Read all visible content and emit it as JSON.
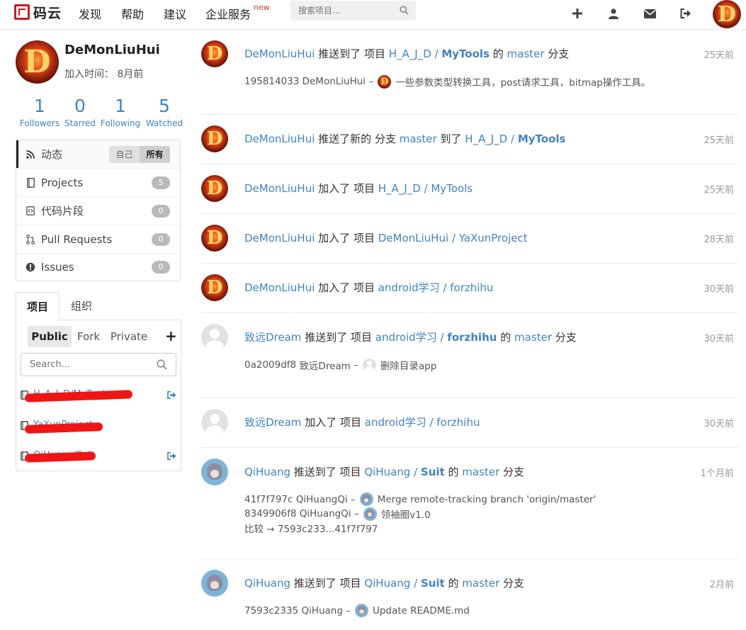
{
  "nav": {
    "logo_text": "码云",
    "items": [
      "发现",
      "帮助",
      "建议",
      "企业服务"
    ],
    "new_tag": "new",
    "search_placeholder": "搜索项目...",
    "avatar_letter": "D"
  },
  "profile": {
    "name": "DeMonLiuHui",
    "joined": "加入时间： 8月前",
    "avatar_letter": "D",
    "stats": [
      {
        "num": "1",
        "label": "Followers"
      },
      {
        "num": "0",
        "label": "Starred"
      },
      {
        "num": "1",
        "label": "Following"
      },
      {
        "num": "5",
        "label": "Watched"
      }
    ]
  },
  "menu": {
    "activity": "动态",
    "toggle_self": "自己",
    "toggle_all": "所有",
    "items": [
      {
        "label": "Projects",
        "count": "5"
      },
      {
        "label": "代码片段",
        "count": "0"
      },
      {
        "label": "Pull Requests",
        "count": "0"
      },
      {
        "label": "Issues",
        "count": "0"
      }
    ]
  },
  "projects_panel": {
    "tabs": [
      "项目",
      "组织"
    ],
    "filters": [
      "Public",
      "Fork",
      "Private"
    ],
    "add": "+",
    "search_placeholder": "Search...",
    "items": [
      "H_A_J_D/MyTools",
      "YaXunProject",
      "QiHuang/Suit"
    ]
  },
  "feed": [
    {
      "avatar": "D",
      "actor": "DeMonLiuHui",
      "action": "推送到了 项目",
      "repo_owner": "H_A_J_D",
      "repo_name": "MyTools",
      "suffix": "的",
      "branch": "master",
      "tail": "分支",
      "time": "25天前",
      "lines": [
        {
          "sha": "195814033",
          "author": "DeMonLiuHui",
          "msg": "一些参数类型转换工具，post请求工具，bitmap操作工具。"
        }
      ]
    },
    {
      "avatar": "D",
      "actor": "DeMonLiuHui",
      "action": "推送了新的 分支",
      "branch": "master",
      "mid": "到了",
      "repo_owner": "H_A_J_D",
      "repo_name": "MyTools",
      "time": "25天前"
    },
    {
      "avatar": "D",
      "actor": "DeMonLiuHui",
      "action": "加入了 项目",
      "repo": "H_A_J_D / MyTools",
      "time": "25天前"
    },
    {
      "avatar": "D",
      "actor": "DeMonLiuHui",
      "action": "加入了 项目",
      "repo": "DeMonLiuHui / YaXunProject",
      "time": "28天前"
    },
    {
      "avatar": "D",
      "actor": "DeMonLiuHui",
      "action": "加入了 项目",
      "repo": "android学习 / forzhihu",
      "time": "30天前"
    },
    {
      "avatar": "grey",
      "actor": "致远Dream",
      "action": "推送到了 项目",
      "repo_owner": "android学习",
      "repo_name": "forzhihu",
      "suffix": "的",
      "branch": "master",
      "tail": "分支",
      "time": "30天前",
      "lines": [
        {
          "sha": "0a2009df8",
          "author": "致远Dream",
          "msg": "删除目录app"
        }
      ]
    },
    {
      "avatar": "grey",
      "actor": "致远Dream",
      "action": "加入了 项目",
      "repo": "android学习 / forzhihu",
      "time": "30天前"
    },
    {
      "avatar": "cat",
      "actor": "QiHuang",
      "action": "推送到了 项目",
      "repo_owner": "QiHuang",
      "repo_name": "Suit",
      "suffix": "的",
      "branch": "master",
      "tail": "分支",
      "time": "1个月前",
      "lines": [
        {
          "sha": "41f7f797c",
          "author": "QiHuangQi",
          "msg": "Merge remote-tracking branch 'origin/master'"
        },
        {
          "sha": "8349906f8",
          "author": "QiHuangQi",
          "msg": "领袖圈v1.0"
        }
      ],
      "compare": "比较 → 7593c233...41f7f797"
    },
    {
      "avatar": "cat",
      "actor": "QiHuang",
      "action": "推送到了 项目",
      "repo_owner": "QiHuang",
      "repo_name": "Suit",
      "suffix": "的",
      "branch": "master",
      "tail": "分支",
      "time": "2月前",
      "lines": [
        {
          "sha": "7593c2335",
          "author": "QiHuang",
          "msg": "Update README.md"
        }
      ]
    }
  ],
  "colors": {
    "link": "#4183c4",
    "brand": "#c71d23",
    "redact": "#f01414"
  }
}
